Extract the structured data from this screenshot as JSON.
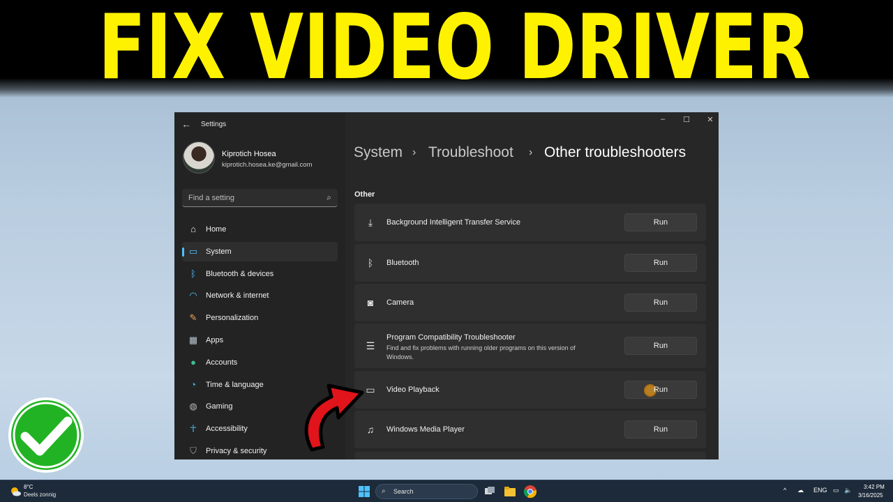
{
  "headline": "FIX VIDEO DRIVER",
  "window": {
    "title": "Settings",
    "back_icon": "back-arrow-icon",
    "controls": {
      "minimize": "–",
      "maximize": "☐",
      "close": "✕"
    }
  },
  "user": {
    "name": "Kiprotich Hosea",
    "email": "kiprotich.hosea.ke@gmail.com"
  },
  "search": {
    "placeholder": "Find a setting",
    "icon": "search-icon"
  },
  "sidebar": {
    "items": [
      {
        "label": "Home",
        "icon": "home-icon",
        "active": false
      },
      {
        "label": "System",
        "icon": "monitor-icon",
        "active": true
      },
      {
        "label": "Bluetooth & devices",
        "icon": "bluetooth-icon",
        "active": false
      },
      {
        "label": "Network & internet",
        "icon": "wifi-icon",
        "active": false
      },
      {
        "label": "Personalization",
        "icon": "brush-icon",
        "active": false
      },
      {
        "label": "Apps",
        "icon": "apps-icon",
        "active": false
      },
      {
        "label": "Accounts",
        "icon": "account-icon",
        "active": false
      },
      {
        "label": "Time & language",
        "icon": "globe-clock-icon",
        "active": false
      },
      {
        "label": "Gaming",
        "icon": "gamepad-icon",
        "active": false
      },
      {
        "label": "Accessibility",
        "icon": "accessibility-icon",
        "active": false
      },
      {
        "label": "Privacy & security",
        "icon": "shield-icon",
        "active": false
      }
    ]
  },
  "breadcrumb": {
    "items": [
      "System",
      "Troubleshoot",
      "Other troubleshooters"
    ],
    "separator": "›"
  },
  "section_label": "Other",
  "troubleshooters": [
    {
      "title": "Background Intelligent Transfer Service",
      "description": "",
      "icon": "download-icon",
      "button": "Run"
    },
    {
      "title": "Bluetooth",
      "description": "",
      "icon": "bluetooth-icon",
      "button": "Run"
    },
    {
      "title": "Camera",
      "description": "",
      "icon": "camera-icon",
      "button": "Run"
    },
    {
      "title": "Program Compatibility Troubleshooter",
      "description": "Find and fix problems with running older programs on this version of Windows.",
      "icon": "list-icon",
      "button": "Run"
    },
    {
      "title": "Video Playback",
      "description": "",
      "icon": "video-camera-icon",
      "button": "Run"
    },
    {
      "title": "Windows Media Player",
      "description": "",
      "icon": "media-player-icon",
      "button": "Run"
    }
  ],
  "taskbar": {
    "weather_temp": "8°C",
    "weather_desc": "Deels zonnig",
    "search_label": "Search",
    "language": "ENG",
    "time": "3:42 PM",
    "date": "3/16/2025"
  },
  "colors": {
    "headline": "#fff200",
    "accent": "#4cc2ff",
    "check_green": "#22b324",
    "arrow_red": "#e0141a"
  }
}
